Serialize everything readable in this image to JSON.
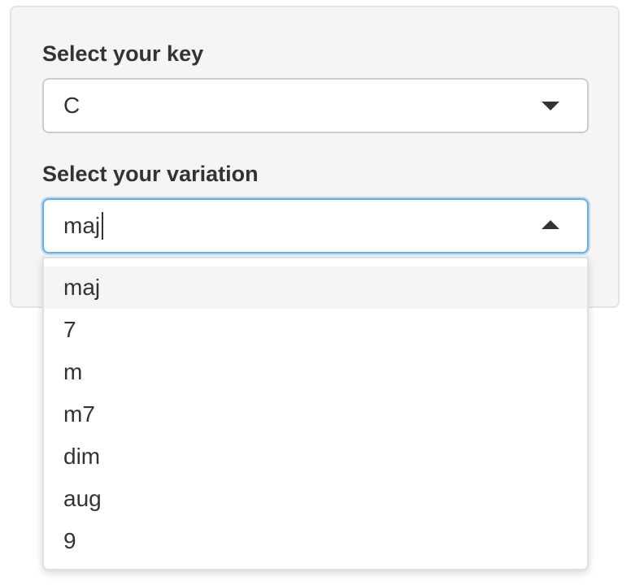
{
  "key_field": {
    "label": "Select your key",
    "value": "C"
  },
  "variation_field": {
    "label": "Select your variation",
    "value": "maj",
    "expanded": true
  },
  "variation_options": [
    "maj",
    "7",
    "m",
    "m7",
    "dim",
    "aug",
    "9"
  ],
  "colors": {
    "panel_bg": "#f5f5f5",
    "focus_border": "#66afe9",
    "active_option_bg": "#f5f5f5",
    "text": "#333333"
  },
  "icons": {
    "key_select": "chevron-down-icon",
    "variation_select": "chevron-up-icon"
  }
}
